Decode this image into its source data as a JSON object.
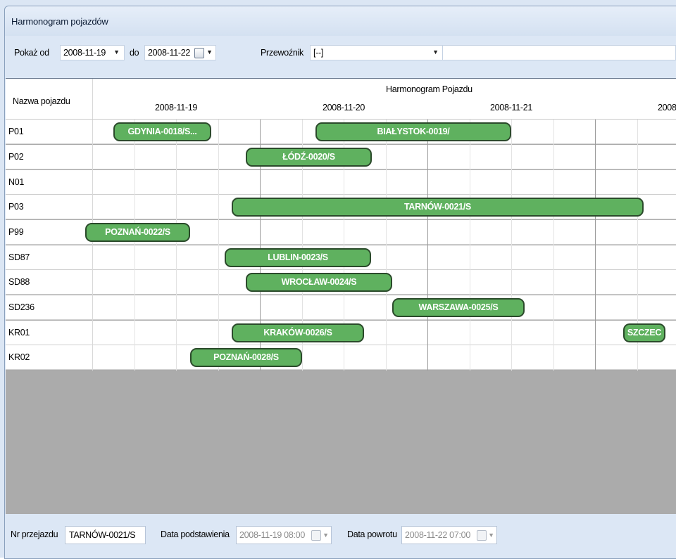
{
  "window": {
    "title": "Harmonogram pojazdów"
  },
  "toolbar": {
    "from_label": "Pokaż od",
    "from_value": "2008-11-19",
    "to_label": "do",
    "to_value": "2008-11-22",
    "carrier_label": "Przewoźnik",
    "carrier_value": "[--]",
    "filter_value": ""
  },
  "schedule": {
    "name_column_header": "Nazwa pojazdu",
    "title": "Harmonogram Pojazdu",
    "dates": [
      "2008-11-19",
      "2008-11-20",
      "2008-11-21",
      "2008-"
    ],
    "rows": [
      {
        "name": "P01"
      },
      {
        "name": "P02"
      },
      {
        "name": "N01"
      },
      {
        "name": "P03"
      },
      {
        "name": "P99"
      },
      {
        "name": "SD87"
      },
      {
        "name": "SD88"
      },
      {
        "name": "SD236"
      },
      {
        "name": "KR01"
      },
      {
        "name": "KR02"
      }
    ],
    "bars": [
      {
        "row": 0,
        "label": "GDYNIA-0018/S...",
        "start": "2008-11-19 03:00",
        "end": "2008-11-19 17:00"
      },
      {
        "row": 0,
        "label": "BIAŁYSTOK-0019/",
        "start": "2008-11-20 08:00",
        "end": "2008-11-21 12:00"
      },
      {
        "row": 1,
        "label": "ŁÓDŹ-0020/S",
        "start": "2008-11-19 22:00",
        "end": "2008-11-20 16:00"
      },
      {
        "row": 3,
        "label": "TARNÓW-0021/S",
        "start": "2008-11-19 20:00",
        "end": "2008-11-22 07:00"
      },
      {
        "row": 4,
        "label": "POZNAŃ-0022/S",
        "start": "2008-11-18 23:00",
        "end": "2008-11-19 14:00"
      },
      {
        "row": 5,
        "label": "LUBLIN-0023/S",
        "start": "2008-11-19 19:00",
        "end": "2008-11-20 16:00"
      },
      {
        "row": 6,
        "label": "WROCŁAW-0024/S",
        "start": "2008-11-19 22:00",
        "end": "2008-11-20 19:00"
      },
      {
        "row": 7,
        "label": "WARSZAWA-0025/S",
        "start": "2008-11-20 19:00",
        "end": "2008-11-21 14:00"
      },
      {
        "row": 8,
        "label": "KRAKÓW-0026/S",
        "start": "2008-11-19 20:00",
        "end": "2008-11-20 15:00"
      },
      {
        "row": 8,
        "label": "SZCZEC",
        "start": "2008-11-22 04:00",
        "end": "2008-11-22 10:00"
      },
      {
        "row": 9,
        "label": "POZNAŃ-0028/S",
        "start": "2008-11-19 14:00",
        "end": "2008-11-20 06:00"
      }
    ]
  },
  "details": {
    "trip_label": "Nr przejazdu",
    "trip_value": "TARNÓW-0021/S",
    "start_label": "Data podstawienia",
    "start_value": "2008-11-19 08:00",
    "return_label": "Data powrotu",
    "return_value": "2008-11-22 07:00"
  },
  "colors": {
    "bar_fill": "#5fb15f",
    "bar_border": "#2b4a2b",
    "empty_area": "#ababab",
    "frame": "#dce7f5"
  }
}
